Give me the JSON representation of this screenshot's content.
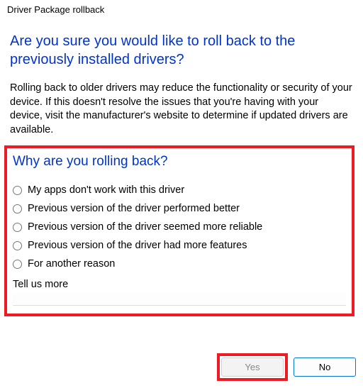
{
  "window": {
    "title": "Driver Package rollback"
  },
  "dialog": {
    "heading": "Are you sure you would like to roll back to the previously installed drivers?",
    "body": "Rolling back to older drivers may reduce the functionality or security of your device. If this doesn't resolve the issues that you're having with your device, visit the manufacturer's website to determine if updated drivers are available.",
    "survey_heading": "Why are you rolling back?",
    "reasons": [
      "My apps don't work with this driver",
      "Previous version of the driver performed better",
      "Previous version of the driver seemed more reliable",
      "Previous version of the driver had more features",
      "For another reason"
    ],
    "tell_more_label": "Tell us more",
    "tell_more_value": ""
  },
  "buttons": {
    "yes": "Yes",
    "no": "No"
  },
  "highlight_color": "#ed1c24"
}
